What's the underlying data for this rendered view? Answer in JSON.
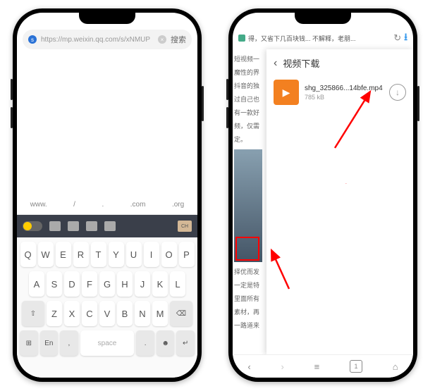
{
  "left": {
    "url": "https://mp.weixin.qq.com/s/xNMUP",
    "search_label": "搜索",
    "suggestions": [
      "www.",
      "/",
      ".",
      ".com",
      ".org"
    ],
    "rows": [
      [
        "Q",
        "W",
        "E",
        "R",
        "T",
        "Y",
        "U",
        "I",
        "O",
        "P"
      ],
      [
        "A",
        "S",
        "D",
        "F",
        "G",
        "H",
        "J",
        "K",
        "L"
      ],
      [
        "Z",
        "X",
        "C",
        "V",
        "B",
        "N",
        "M"
      ]
    ],
    "space_label": "space",
    "lang_label": "En"
  },
  "right": {
    "tab_title": "得，又省下几百块钱... 不解释，老朋...",
    "panel_title": "视频下载",
    "file_name": "shg_325866...14bfe.mp4",
    "file_size": "785 kB",
    "article_lines": [
      "短视频一",
      "魔性的界",
      "抖音的独",
      "过自己也",
      "有一款好",
      "频，仅需",
      "定。"
    ],
    "article_lines2": [
      "择优而发",
      "一定是特",
      "里面所有",
      "素材，再",
      "一路道来"
    ],
    "tab_count": "1"
  }
}
